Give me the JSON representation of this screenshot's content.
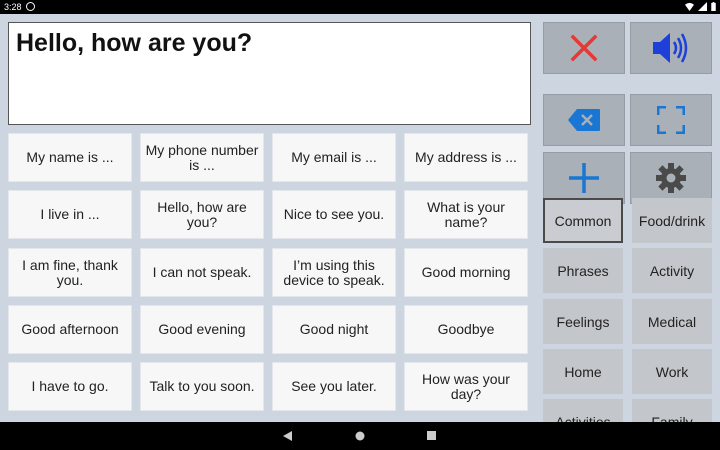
{
  "status": {
    "time": "3:28"
  },
  "text_box": {
    "value": "Hello, how are you?"
  },
  "phrases": [
    "My name is ...",
    "My phone number is ...",
    "My email is ...",
    "My address is ...",
    "I live in ...",
    "Hello, how are you?",
    "Nice to see you.",
    "What is your name?",
    "I am fine, thank you.",
    "I can not speak.",
    "I’m using this device to speak.",
    "Good morning",
    "Good afternoon",
    "Good evening",
    "Good night",
    "Goodbye",
    "I have to go.",
    "Talk to you soon.",
    "See you later.",
    "How was your day?"
  ],
  "tools": [
    {
      "name": "clear-button",
      "icon": "close-icon"
    },
    {
      "name": "speak-button",
      "icon": "speaker-icon"
    },
    {
      "name": "backspace-button",
      "icon": "backspace-icon"
    },
    {
      "name": "fullscreen-button",
      "icon": "fullscreen-icon"
    },
    {
      "name": "add-button",
      "icon": "plus-icon"
    },
    {
      "name": "settings-button",
      "icon": "gear-icon"
    }
  ],
  "categories": [
    "Common",
    "Food/drink",
    "Phrases",
    "Activity",
    "Feelings",
    "Medical",
    "Home",
    "Work",
    "Activities",
    "Family"
  ],
  "selected_category": "Common",
  "colors": {
    "clear": "#e53935",
    "speak": "#1e3fd8",
    "accent": "#1976d2",
    "gear": "#4a4a4a"
  }
}
